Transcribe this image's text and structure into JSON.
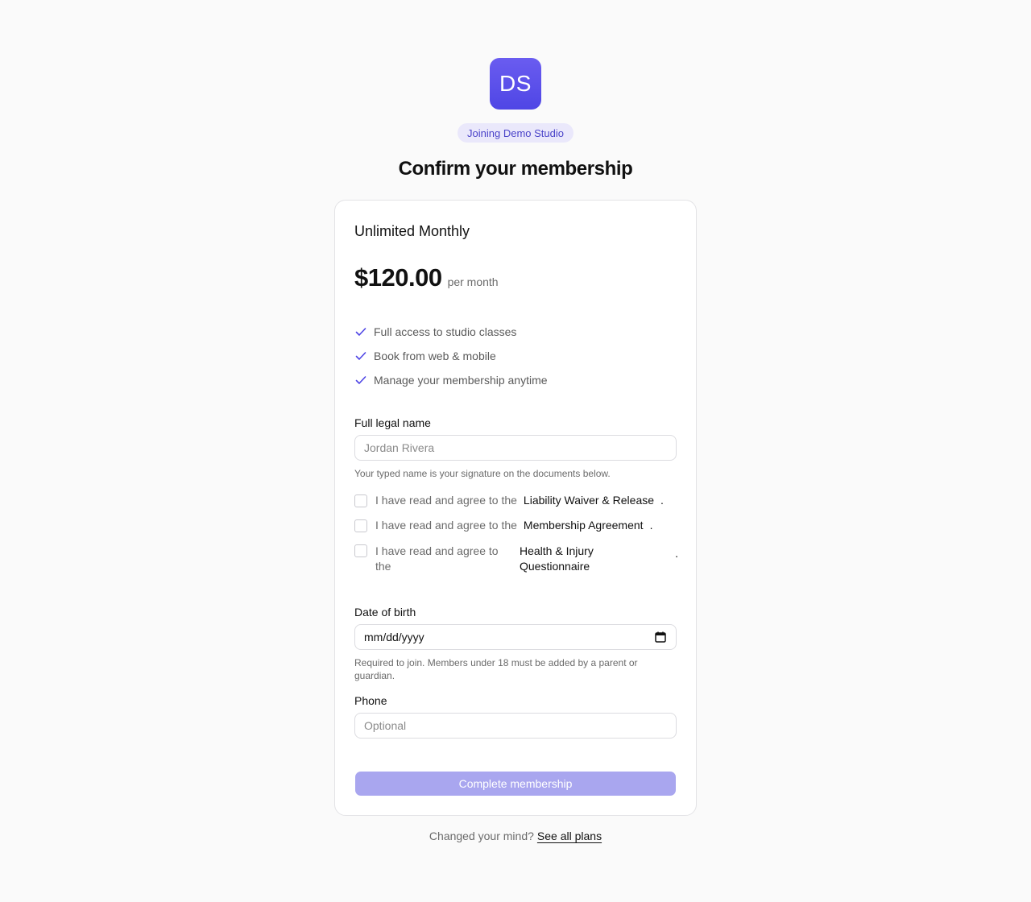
{
  "studio": {
    "logo_initials": "DS",
    "joining_badge": "Joining Demo Studio"
  },
  "page_title": "Confirm your membership",
  "plan": {
    "name": "Unlimited Monthly",
    "price": "$120.00",
    "period": "per month",
    "features": [
      "Full access to studio classes",
      "Book from web & mobile",
      "Manage your membership anytime"
    ]
  },
  "form": {
    "legal_name": {
      "label": "Full legal name",
      "placeholder": "Jordan Rivera",
      "value": "",
      "hint": "Your typed name is your signature on the documents below."
    },
    "agreements": [
      {
        "prefix": "I have read and agree to the",
        "document": "Liability Waiver & Release",
        "suffix": ".",
        "checked": false
      },
      {
        "prefix": "I have read and agree to the",
        "document": "Membership Agreement",
        "suffix": ".",
        "checked": false
      },
      {
        "prefix": "I have read and agree to the",
        "document": "Health & Injury Questionnaire",
        "suffix": ".",
        "checked": false
      }
    ],
    "dob": {
      "label": "Date of birth",
      "placeholder": "mm/dd/yyyy",
      "hint": "Required to join. Members under 18 must be added by a parent or guardian."
    },
    "phone": {
      "label": "Phone",
      "placeholder": "Optional",
      "value": ""
    },
    "submit_label": "Complete membership"
  },
  "footer": {
    "text": "Changed your mind?",
    "link": "See all plans"
  },
  "colors": {
    "accent": "#4f46e5",
    "badge_bg": "#eae8fb",
    "submit_disabled": "#a9a6ef"
  },
  "icons": {
    "feature": "check-icon",
    "date": "calendar-icon"
  }
}
